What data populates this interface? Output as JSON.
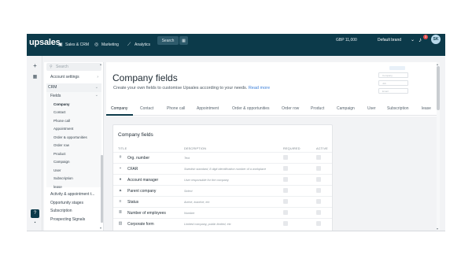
{
  "topbar": {
    "logo": "upsales",
    "nav": [
      {
        "icon": "briefcase-icon",
        "glyph": "▣",
        "label": "Sales & CRM"
      },
      {
        "icon": "globe-icon",
        "glyph": "◎",
        "label": "Marketing"
      },
      {
        "icon": "chart-icon",
        "glyph": "⟋",
        "label": "Analytics"
      }
    ],
    "search_label": "Search",
    "grid_glyph": "▦",
    "currency": "GBP 11,000",
    "brand": "Default brand",
    "notification_count": "3",
    "user_initials": "SK"
  },
  "rail": {
    "add": "+",
    "calendar": "▦",
    "help": "?",
    "chat": "▪"
  },
  "settings": {
    "search_placeholder": "Search",
    "account_settings": "Account settings",
    "crm": "CRM",
    "fields": "Fields",
    "field_items": [
      "Company",
      "Contact",
      "Phone call",
      "Appointment",
      "Order & opportunities",
      "Order row",
      "Product",
      "Campaign",
      "User",
      "Subscription",
      "lease"
    ],
    "bottom_items": [
      "Activity & appointment t...",
      "Opportunity stages",
      "Subscription",
      "Prospecting Signals"
    ]
  },
  "main": {
    "title": "Company fields",
    "description": "Create your own fields to customise Upsales according to your needs.",
    "read_more": "Read more",
    "illustration": [
      "Company",
      "Job",
      "Email"
    ],
    "tabs": [
      "Company",
      "Contact",
      "Phone call",
      "Appointment",
      "Order & opportunities",
      "Order row",
      "Product",
      "Campaign",
      "User",
      "Subscription",
      "lease"
    ],
    "card_title": "Company fields",
    "columns": {
      "title": "TITLE",
      "description": "DESCRIPTION",
      "required": "REQUIRED",
      "active": "ACTIVE"
    },
    "rows": [
      {
        "icon": "hash-icon",
        "glyph": "#",
        "title": "Org. number",
        "description": "Text"
      },
      {
        "icon": "tag-icon",
        "glyph": "▪",
        "title": "CFAR",
        "description": "Swedish standard, 8 digit identification number of a workplace"
      },
      {
        "icon": "user-icon",
        "glyph": "●",
        "title": "Account manager",
        "description": "User responsible for the company"
      },
      {
        "icon": "sitemap-icon",
        "glyph": "▲",
        "title": "Parent company",
        "description": "Select"
      },
      {
        "icon": "status-icon",
        "glyph": "≡",
        "title": "Status",
        "description": "Active, inactive, etc"
      },
      {
        "icon": "employees-icon",
        "glyph": "≣",
        "title": "Number of employees",
        "description": "Number"
      },
      {
        "icon": "building-icon",
        "glyph": "▥",
        "title": "Corporate form",
        "description": "Limited company, public limited, etc"
      }
    ]
  },
  "colors": {
    "topbar": "#0c3a4a",
    "accent": "#3b7fd9",
    "badge": "#e34b4b"
  }
}
